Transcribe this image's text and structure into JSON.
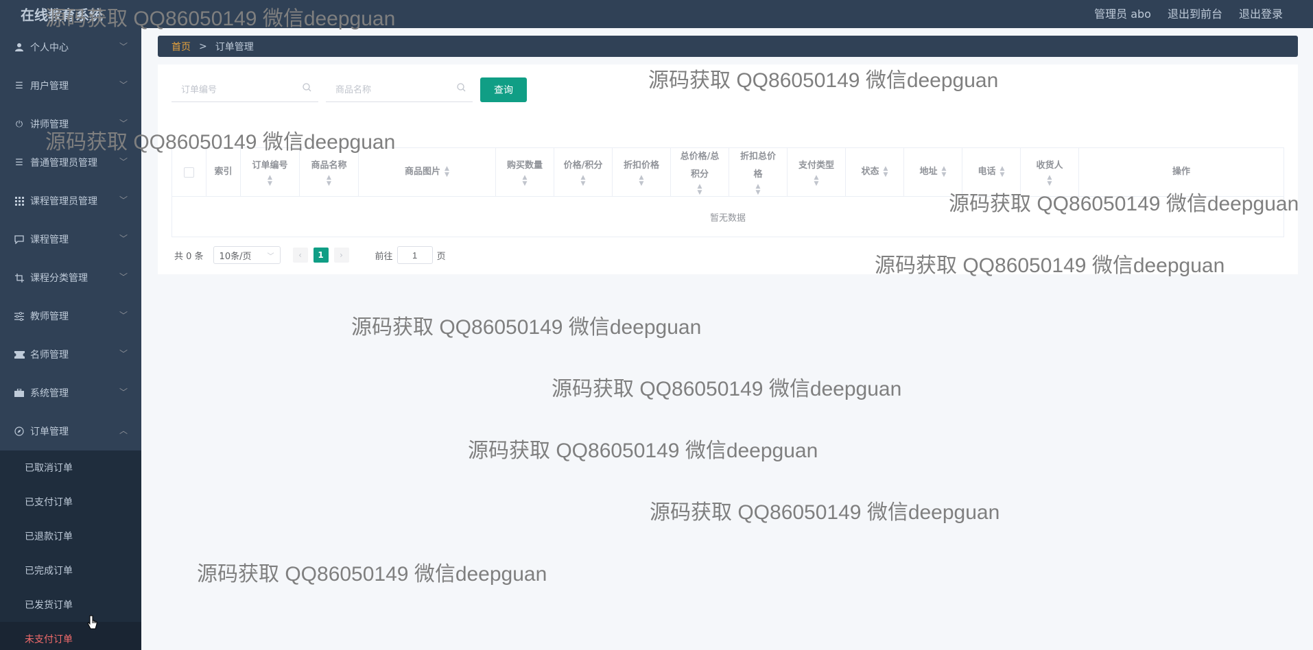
{
  "header": {
    "app_title": "在线教育系统",
    "user_label": "管理员 abo",
    "to_frontend": "退出到前台",
    "logout": "退出登录"
  },
  "sidebar": {
    "items": [
      {
        "label": "个人中心",
        "icon": "user-icon"
      },
      {
        "label": "用户管理",
        "icon": "list-icon"
      },
      {
        "label": "讲师管理",
        "icon": "power-icon"
      },
      {
        "label": "普通管理员管理",
        "icon": "list-icon"
      },
      {
        "label": "课程管理员管理",
        "icon": "grid-icon"
      },
      {
        "label": "课程管理",
        "icon": "chat-icon"
      },
      {
        "label": "课程分类管理",
        "icon": "crop-icon"
      },
      {
        "label": "教师管理",
        "icon": "sliders-icon"
      },
      {
        "label": "名师管理",
        "icon": "ticket-icon"
      },
      {
        "label": "系统管理",
        "icon": "briefcase-icon"
      },
      {
        "label": "订单管理",
        "icon": "compass-icon"
      }
    ],
    "sub_items": [
      "已取消订单",
      "已支付订单",
      "已退款订单",
      "已完成订单",
      "已发货订单",
      "未支付订单"
    ],
    "active_sub": "未支付订单"
  },
  "breadcrumb": {
    "home": "首页",
    "separator": ">",
    "current": "订单管理"
  },
  "search": {
    "order_no_placeholder": "订单编号",
    "product_name_placeholder": "商品名称",
    "query_button": "查询"
  },
  "table": {
    "columns": [
      "索引",
      "订单编号",
      "商品名称",
      "商品图片",
      "购买数量",
      "价格/积分",
      "折扣价格",
      "总价格/总积分",
      "折扣总价格",
      "支付类型",
      "状态",
      "地址",
      "电话",
      "收货人",
      "操作"
    ],
    "empty_text": "暂无数据"
  },
  "pagination": {
    "total_label": "共 0 条",
    "page_size": "10条/页",
    "current_page": "1",
    "goto_prefix": "前往",
    "goto_value": "1",
    "goto_suffix": "页"
  },
  "watermark": "源码获取 QQ86050149 微信deepguan",
  "colors": {
    "sidebar_bg": "#304156",
    "primary": "#109e85",
    "active_menu": "#f56c6c",
    "breadcrumb_home": "#e6a23c"
  }
}
